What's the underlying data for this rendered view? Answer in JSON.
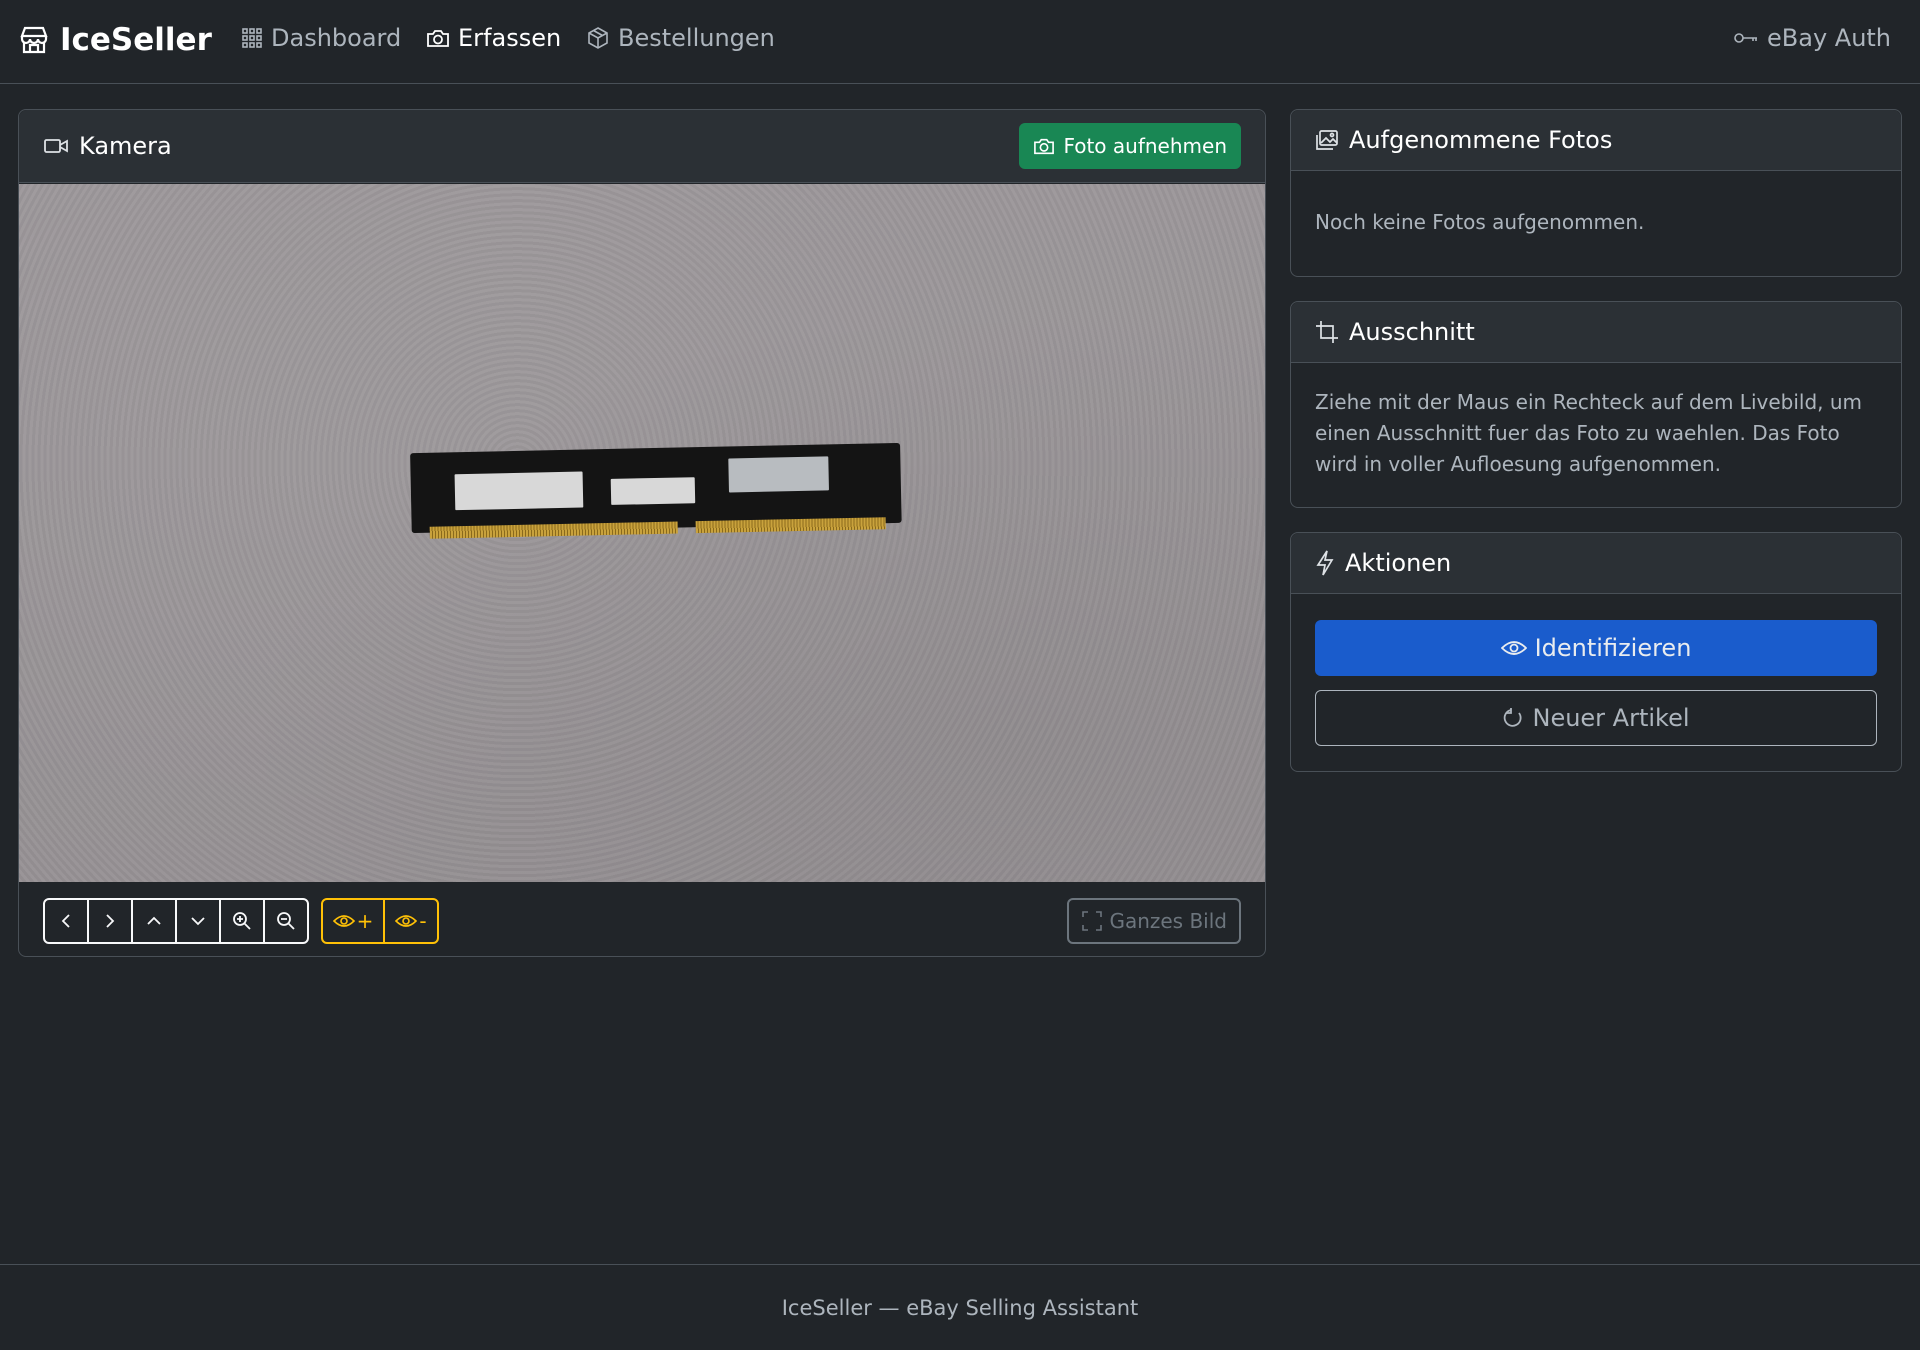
{
  "navbar": {
    "brand": "IceSeller",
    "items": [
      {
        "label": "Dashboard",
        "icon": "grid-icon"
      },
      {
        "label": "Erfassen",
        "icon": "camera-icon"
      },
      {
        "label": "Bestellungen",
        "icon": "box-icon"
      }
    ],
    "auth_label": "eBay Auth"
  },
  "camera": {
    "title": "Kamera",
    "capture_label": "Foto aufnehmen",
    "eye_plus_label": "+",
    "eye_minus_label": "-",
    "whole_image_label": "Ganzes Bild"
  },
  "photos": {
    "title": "Aufgenommene Fotos",
    "empty_text": "Noch keine Fotos aufgenommen."
  },
  "crop": {
    "title": "Ausschnitt",
    "text": "Ziehe mit der Maus ein Rechteck auf dem Livebild, um einen Ausschnitt fuer das Foto zu waehlen. Das Foto wird in voller Aufloesung aufgenommen."
  },
  "actions": {
    "title": "Aktionen",
    "identify_label": "Identifizieren",
    "new_item_label": "Neuer Artikel"
  },
  "footer": {
    "text": "IceSeller — eBay Selling Assistant"
  },
  "colors": {
    "background": "#212529",
    "success": "#198754",
    "primary": "#1a5ccc",
    "warning": "#ffc107"
  }
}
